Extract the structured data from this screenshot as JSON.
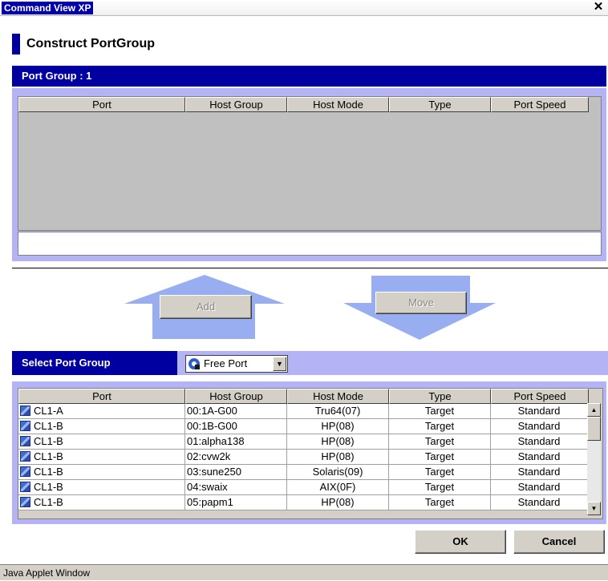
{
  "window": {
    "title": "Command View XP",
    "close": "✕"
  },
  "header": {
    "title": "Construct PortGroup"
  },
  "port_group_bar": {
    "label": "Port Group : 1"
  },
  "columns": [
    "Port",
    "Host Group",
    "Host Mode",
    "Type",
    "Port Speed"
  ],
  "buttons": {
    "add": "Add",
    "move": "Move",
    "ok": "OK",
    "cancel": "Cancel"
  },
  "select_group": {
    "label": "Select Port Group",
    "selected": "Free Port"
  },
  "rows": [
    {
      "port": "CL1-A",
      "host_group": "00:1A-G00",
      "host_mode": "Tru64(07)",
      "type": "Target",
      "speed": "Standard"
    },
    {
      "port": "CL1-B",
      "host_group": "00:1B-G00",
      "host_mode": "HP(08)",
      "type": "Target",
      "speed": "Standard"
    },
    {
      "port": "CL1-B",
      "host_group": "01:alpha138",
      "host_mode": "HP(08)",
      "type": "Target",
      "speed": "Standard"
    },
    {
      "port": "CL1-B",
      "host_group": "02:cvw2k",
      "host_mode": "HP(08)",
      "type": "Target",
      "speed": "Standard"
    },
    {
      "port": "CL1-B",
      "host_group": "03:sune250",
      "host_mode": "Solaris(09)",
      "type": "Target",
      "speed": "Standard"
    },
    {
      "port": "CL1-B",
      "host_group": "04:swaix",
      "host_mode": "AIX(0F)",
      "type": "Target",
      "speed": "Standard"
    },
    {
      "port": "CL1-B",
      "host_group": "05:papm1",
      "host_mode": "HP(08)",
      "type": "Target",
      "speed": "Standard"
    }
  ],
  "status_bar": {
    "text": "Java Applet Window"
  },
  "colors": {
    "accent": "#0000a0",
    "panel": "#b3b3f5",
    "arrow": "#99aef0"
  }
}
